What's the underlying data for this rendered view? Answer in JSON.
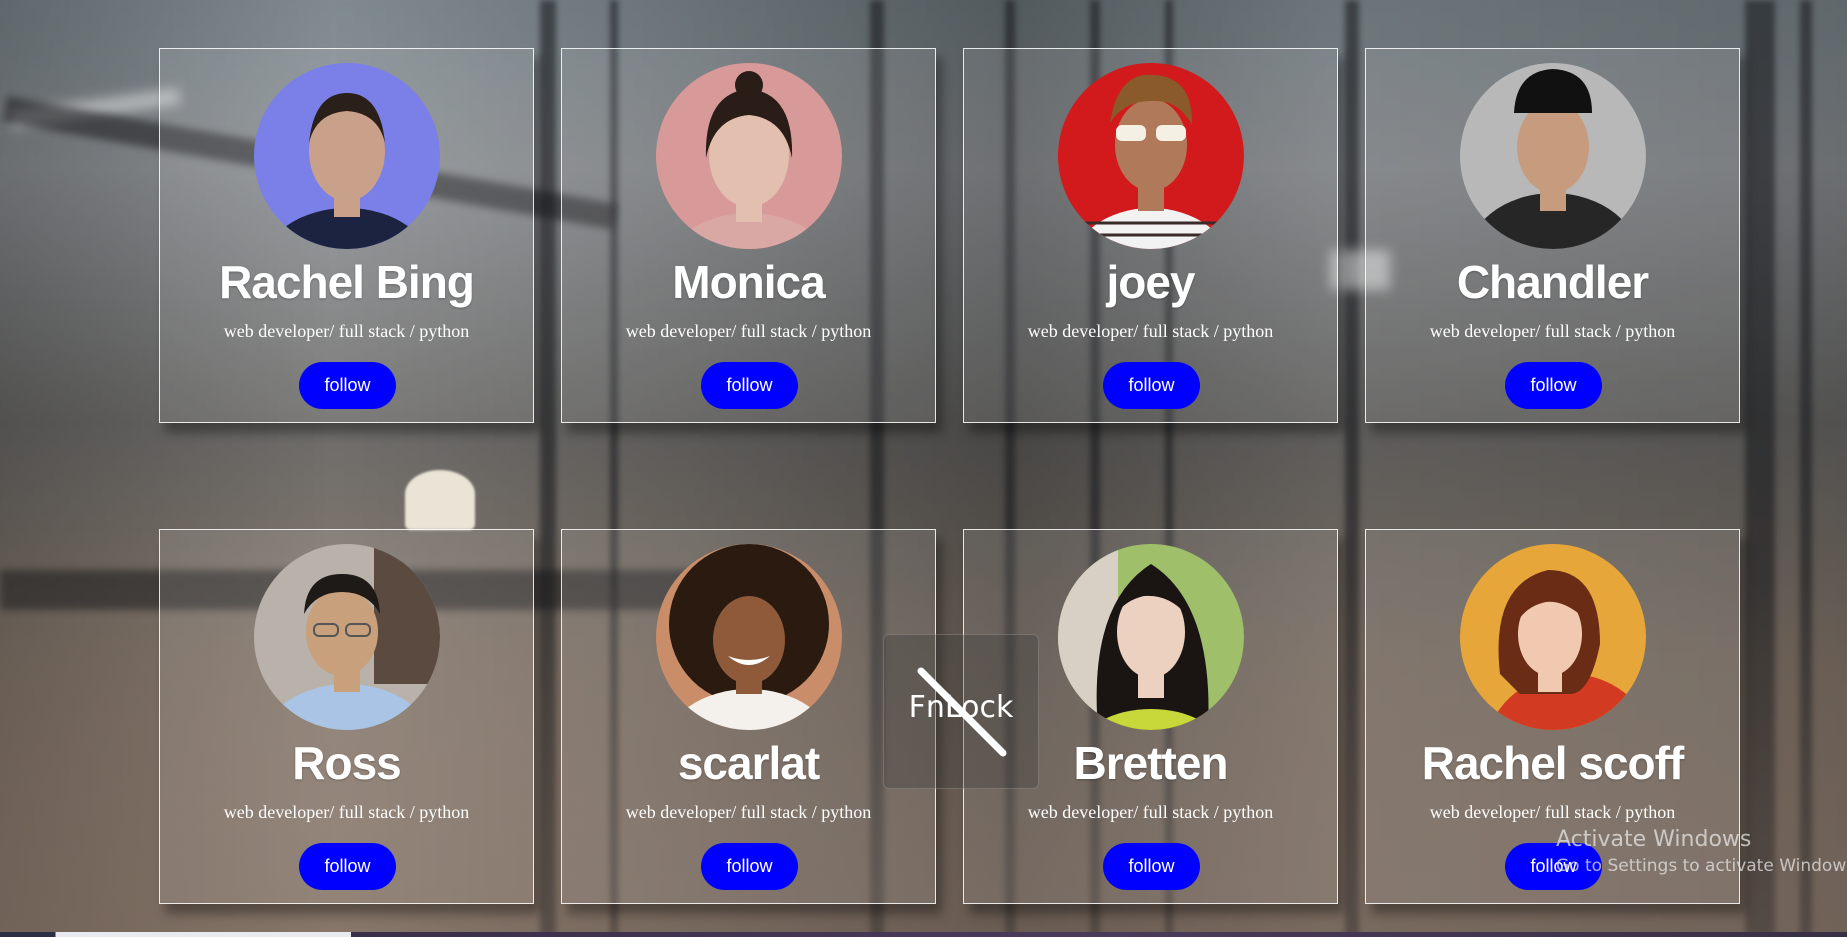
{
  "cards": [
    {
      "name": "Rachel Bing",
      "role": "web developer/ full stack / python",
      "button": "follow",
      "avatar_color": "#7a80e8",
      "skin": "#c9a08a",
      "hair": "#2b1f1a",
      "shirt": "#1c2340"
    },
    {
      "name": "Monica",
      "role": "web developer/ full stack / python",
      "button": "follow",
      "avatar_color": "#d89a98",
      "skin": "#e2bfae",
      "hair": "#2a1c16",
      "shirt": "#d9a8a4"
    },
    {
      "name": "joey",
      "role": "web developer/ full stack / python",
      "button": "follow",
      "avatar_color": "#d2191c",
      "skin": "#b07a5a",
      "hair": "#8a5a2a",
      "shirt": "#f2f2f2"
    },
    {
      "name": "Chandler",
      "role": "web developer/ full stack / python",
      "button": "follow",
      "avatar_color": "#b8b8b8",
      "skin": "#c79c7e",
      "hair": "#111111",
      "shirt": "#262626"
    },
    {
      "name": "Ross",
      "role": "web developer/ full stack / python",
      "button": "follow",
      "avatar_color": "#b9b2aa",
      "skin": "#c9a07c",
      "hair": "#1e1a18",
      "shirt": "#a9c4e4"
    },
    {
      "name": "scarlat",
      "role": "web developer/ full stack / python",
      "button": "follow",
      "avatar_color": "#c98d6a",
      "skin": "#8f5a3a",
      "hair": "#2a1a10",
      "shirt": "#f4f0ec"
    },
    {
      "name": "Bretten",
      "role": "web developer/ full stack / python",
      "button": "follow",
      "avatar_color": "#9fbf6a",
      "skin": "#ecd0c0",
      "hair": "#1a1412",
      "shirt": "#c8d83a"
    },
    {
      "name": "Rachel scoff",
      "role": "web developer/ full stack / python",
      "button": "follow",
      "avatar_color": "#e7a63a",
      "skin": "#f0c9b0",
      "hair": "#6a2c14",
      "shirt": "#d23a22"
    }
  ],
  "overlay": {
    "fnlock_label": "FnLock"
  },
  "watermark": {
    "title": "Activate Windows",
    "subtitle": "Go to Settings to activate Windows."
  },
  "colors": {
    "button_bg": "#0000ff",
    "button_text": "#ffffff",
    "card_border": "#ffffff"
  }
}
